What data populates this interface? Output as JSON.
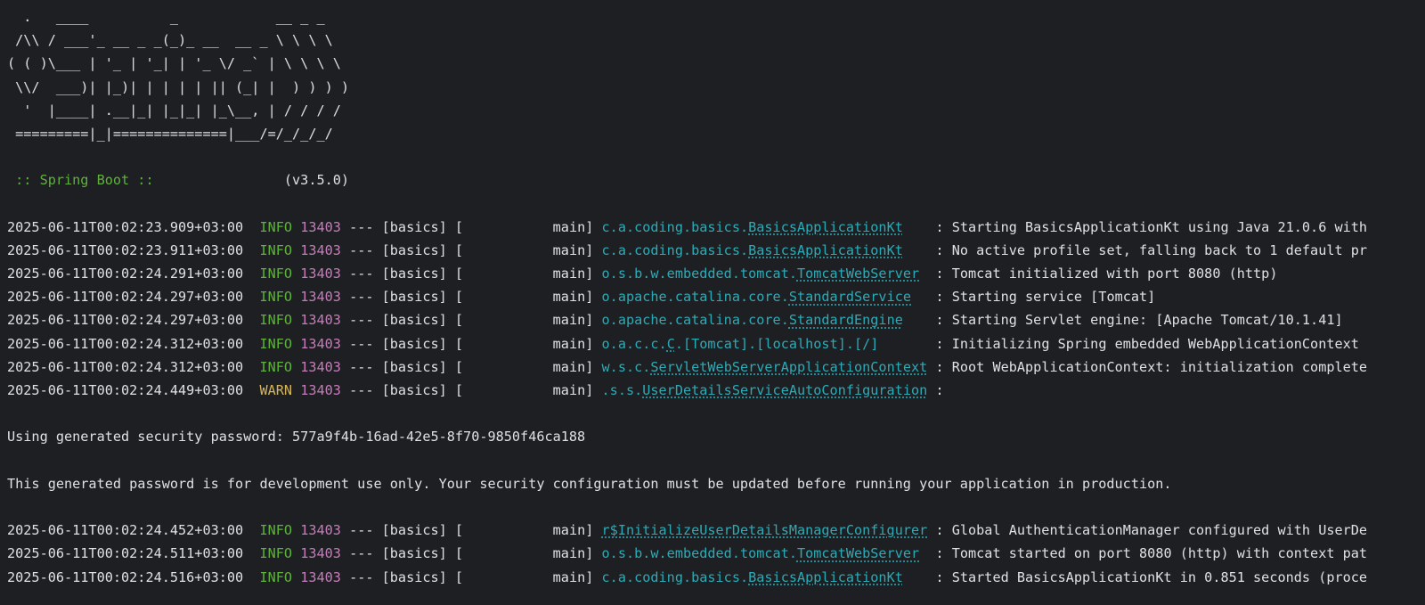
{
  "banner": [
    "  .   ____          _            __ _ _",
    " /\\\\ / ___'_ __ _ _(_)_ __  __ _ \\ \\ \\ \\",
    "( ( )\\___ | '_ | '_| | '_ \\/ _` | \\ \\ \\ \\",
    " \\\\/  ___)| |_)| | | | | || (_| |  ) ) ) )",
    "  '  |____| .__|_| |_|_| |_\\__, | / / / /",
    " =========|_|==============|___/=/_/_/_/"
  ],
  "spring_label": " :: Spring Boot :: ",
  "spring_version": "               (v3.5.0)",
  "logs_before": [
    {
      "ts": "2025-06-11T00:02:23.909+03:00",
      "level": "INFO",
      "pid": "13403",
      "sep": " --- [basics] [           main] ",
      "logger_pkg": "c.a.coding.basics.",
      "logger_cls": "BasicsApplicationKt",
      "pad": "    ",
      "message": ": Starting BasicsApplicationKt using Java 21.0.6 with"
    },
    {
      "ts": "2025-06-11T00:02:23.911+03:00",
      "level": "INFO",
      "pid": "13403",
      "sep": " --- [basics] [           main] ",
      "logger_pkg": "c.a.coding.basics.",
      "logger_cls": "BasicsApplicationKt",
      "pad": "    ",
      "message": ": No active profile set, falling back to 1 default pr"
    },
    {
      "ts": "2025-06-11T00:02:24.291+03:00",
      "level": "INFO",
      "pid": "13403",
      "sep": " --- [basics] [           main] ",
      "logger_pkg": "o.s.b.w.embedded.tomcat.",
      "logger_cls": "TomcatWebServer",
      "pad": "  ",
      "message": ": Tomcat initialized with port 8080 (http)"
    },
    {
      "ts": "2025-06-11T00:02:24.297+03:00",
      "level": "INFO",
      "pid": "13403",
      "sep": " --- [basics] [           main] ",
      "logger_pkg": "o.apache.catalina.core.",
      "logger_cls": "StandardService",
      "pad": "   ",
      "message": ": Starting service [Tomcat]"
    },
    {
      "ts": "2025-06-11T00:02:24.297+03:00",
      "level": "INFO",
      "pid": "13403",
      "sep": " --- [basics] [           main] ",
      "logger_pkg": "o.apache.catalina.core.",
      "logger_cls": "StandardEngine",
      "pad": "    ",
      "message": ": Starting Servlet engine: [Apache Tomcat/10.1.41]"
    },
    {
      "ts": "2025-06-11T00:02:24.312+03:00",
      "level": "INFO",
      "pid": "13403",
      "sep": " --- [basics] [           main] ",
      "logger_pkg": "o.a.c.c.",
      "logger_cls": "C",
      "logger_tail": ".[Tomcat].[localhost].[/]",
      "pad": "       ",
      "message": ": Initializing Spring embedded WebApplicationContext"
    },
    {
      "ts": "2025-06-11T00:02:24.312+03:00",
      "level": "INFO",
      "pid": "13403",
      "sep": " --- [basics] [           main] ",
      "logger_pkg": "w.s.c.",
      "logger_cls": "ServletWebServerApplicationContext",
      "pad": " ",
      "message": ": Root WebApplicationContext: initialization complete"
    },
    {
      "ts": "2025-06-11T00:02:24.449+03:00",
      "level": "WARN",
      "pid": "13403",
      "sep": " --- [basics] [           main] ",
      "logger_pkg": ".s.s.",
      "logger_cls": "UserDetailsServiceAutoConfiguration",
      "pad": " ",
      "message": ":"
    }
  ],
  "password_line": "Using generated security password: 577a9f4b-16ad-42e5-8f70-9850f46ca188",
  "dev_notice": "This generated password is for development use only. Your security configuration must be updated before running your application in production.",
  "logs_after": [
    {
      "ts": "2025-06-11T00:02:24.452+03:00",
      "level": "INFO",
      "pid": "13403",
      "sep": " --- [basics] [           main] ",
      "logger_pkg": "",
      "logger_cls": "r$InitializeUserDetailsManagerConfigurer",
      "pad": " ",
      "message": ": Global AuthenticationManager configured with UserDe"
    },
    {
      "ts": "2025-06-11T00:02:24.511+03:00",
      "level": "INFO",
      "pid": "13403",
      "sep": " --- [basics] [           main] ",
      "logger_pkg": "o.s.b.w.embedded.tomcat.",
      "logger_cls": "TomcatWebServer",
      "pad": "  ",
      "message": ": Tomcat started on port 8080 (http) with context pat"
    },
    {
      "ts": "2025-06-11T00:02:24.516+03:00",
      "level": "INFO",
      "pid": "13403",
      "sep": " --- [basics] [           main] ",
      "logger_pkg": "c.a.coding.basics.",
      "logger_cls": "BasicsApplicationKt",
      "pad": "    ",
      "message": ": Started BasicsApplicationKt in 0.851 seconds (proce"
    }
  ],
  "colors": {
    "background": "#1e1f22",
    "text": "#dfe1e5",
    "info": "#5fb33b",
    "warn": "#d5b55a",
    "pid": "#c77dbb",
    "logger": "#2aacb8"
  }
}
